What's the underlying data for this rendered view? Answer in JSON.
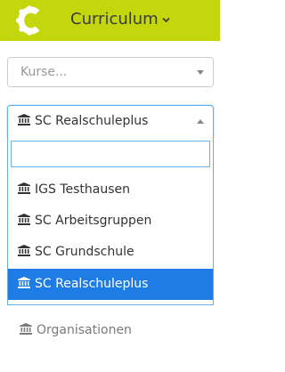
{
  "header": {
    "brand": "Curriculum",
    "colors": {
      "bar": "#c4d60c",
      "logo": "#ffffff"
    },
    "icons": {
      "logo": "curriculum-c-logo-icon",
      "caret": "chevron-down-icon"
    }
  },
  "courses_select": {
    "placeholder": "Kurse...",
    "icon": "caret-down-icon"
  },
  "organization_select": {
    "selected": "SC Realschuleplus",
    "icon": "institution-icon",
    "arrow_icon": "caret-up-icon",
    "accent": "#66afe9",
    "search": {
      "value": "",
      "placeholder": ""
    },
    "options": [
      {
        "label": "IGS Testhausen",
        "selected": false
      },
      {
        "label": "SC Arbeitsgruppen",
        "selected": false
      },
      {
        "label": "SC Grundschule",
        "selected": false
      },
      {
        "label": "SC Realschuleplus",
        "selected": true
      }
    ],
    "highlight_color": "#1d7ce6"
  },
  "nav": {
    "organisationen_label": "Organisationen",
    "icon": "institution-icon"
  }
}
